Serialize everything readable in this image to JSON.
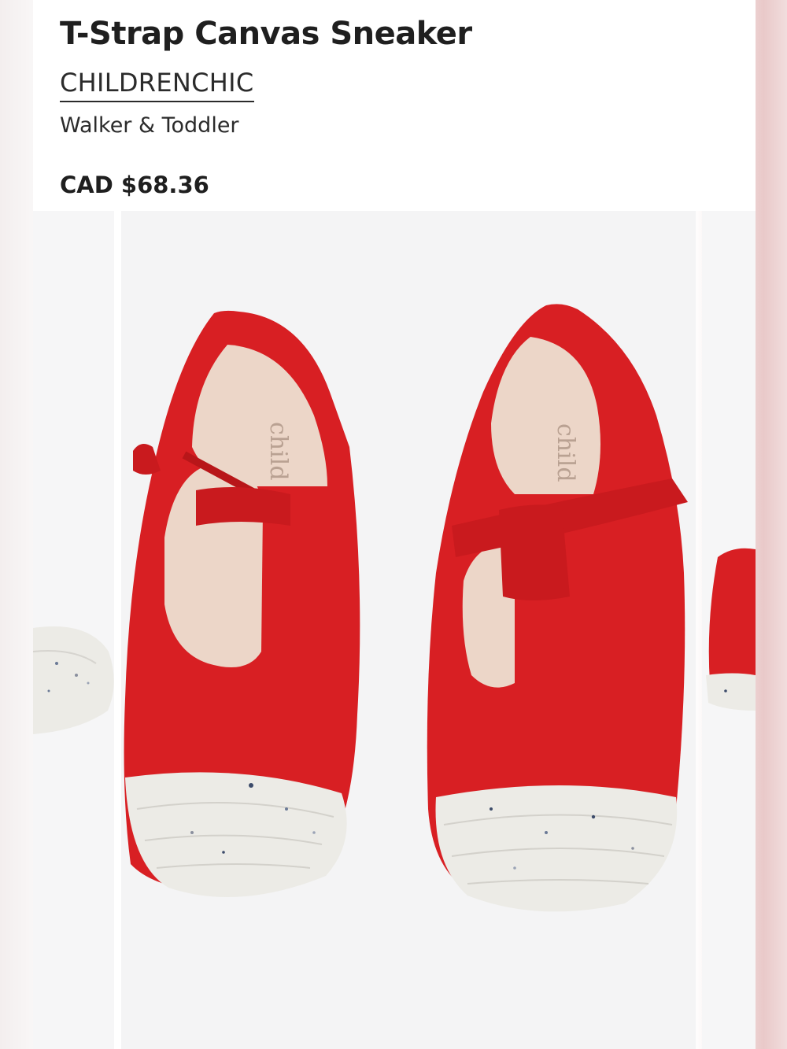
{
  "product": {
    "title": "T-Strap Canvas Sneaker",
    "brand": "CHILDRENCHIC",
    "category": "Walker & Toddler",
    "price": "CAD $68.36"
  },
  "gallery": {
    "insole_text": "child",
    "colors": {
      "canvas": "#d81f23",
      "sole": "#ecebe6",
      "insole": "#ecd6c8"
    }
  }
}
